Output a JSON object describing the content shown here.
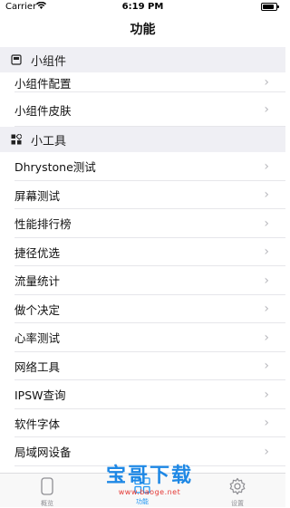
{
  "status_bar": {
    "carrier": "Carrier",
    "wifi_icon": "wifi-icon",
    "time": "6:19 PM",
    "battery_icon": "battery-icon"
  },
  "nav": {
    "title": "功能"
  },
  "sections": [
    {
      "header": "小组件",
      "icon": "widget-icon",
      "rows": [
        {
          "label": "小组件配置"
        },
        {
          "label": "小组件皮肤"
        }
      ]
    },
    {
      "header": "小工具",
      "icon": "tools-icon",
      "rows": [
        {
          "label": "Dhrystone测试"
        },
        {
          "label": "屏幕测试"
        },
        {
          "label": "性能排行榜"
        },
        {
          "label": "捷径优选"
        },
        {
          "label": "流量统计"
        },
        {
          "label": "做个决定"
        },
        {
          "label": "心率测试"
        },
        {
          "label": "网络工具"
        },
        {
          "label": "IPSW查询"
        },
        {
          "label": "软件字体"
        },
        {
          "label": "局域网设备"
        }
      ]
    }
  ],
  "tabs": [
    {
      "label": "概览",
      "icon": "phone-icon"
    },
    {
      "label": "功能",
      "icon": "grid-icon",
      "active": true
    },
    {
      "label": "设置",
      "icon": "gear-icon"
    }
  ],
  "watermark": {
    "title": "宝哥下载",
    "url": "www.baoge.net"
  },
  "colors": {
    "accent": "#2196f3",
    "section_bg": "#efeff4",
    "chevron": "#b8b8bd",
    "watermark_blue": "#1e88e5",
    "watermark_red": "#e53935"
  }
}
